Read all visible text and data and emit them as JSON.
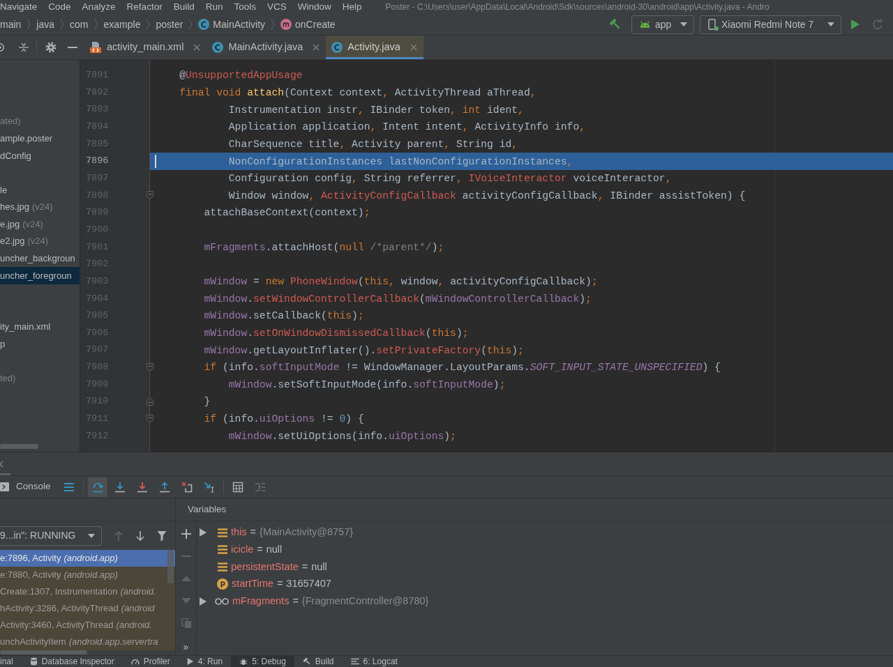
{
  "menu_bar": {
    "items": [
      "Navigate",
      "Code",
      "Analyze",
      "Refactor",
      "Build",
      "Run",
      "Tools",
      "VCS",
      "Window",
      "Help"
    ],
    "title": "Poster - C:\\Users\\user\\AppData\\Local\\Android\\Sdk\\sources\\android-30\\android\\app\\Activity.java - Andro"
  },
  "nav_bar": {
    "breadcrumbs": [
      {
        "text": "main",
        "kind": "folder"
      },
      {
        "text": "java",
        "kind": "folder"
      },
      {
        "text": "com",
        "kind": "folder"
      },
      {
        "text": "example",
        "kind": "folder"
      },
      {
        "text": "poster",
        "kind": "folder"
      },
      {
        "text": "MainActivity",
        "kind": "class"
      },
      {
        "text": "onCreate",
        "kind": "method"
      }
    ],
    "run_configuration": {
      "label": "app"
    },
    "device": {
      "label": "Xiaomi Redmi Note 7",
      "connected": true
    },
    "run_buttons": [
      {
        "kind": "run",
        "disabled": false
      },
      {
        "kind": "apply_changes",
        "disabled": true
      }
    ]
  },
  "editor_tabs": [
    {
      "label": "activity_main.xml",
      "kind": "xml",
      "selected": false
    },
    {
      "label": "MainActivity.java",
      "kind": "class",
      "selected": false
    },
    {
      "label": "Activity.java",
      "kind": "class",
      "selected": true
    }
  ],
  "project_tree": {
    "rows": [
      null,
      null,
      null,
      {
        "note": "ated)",
        "selected": false
      },
      {
        "text": "ample.poster",
        "selected": false
      },
      {
        "text": "dConfig",
        "selected": false
      },
      null,
      {
        "text": "le",
        "selected": false
      },
      {
        "text": "hes.jpg",
        "note": "(v24)",
        "selected": false
      },
      {
        "text": "e.jpg",
        "note": "(v24)",
        "selected": false
      },
      {
        "text": "e2.jpg",
        "note": "(v24)",
        "selected": false
      },
      {
        "text": "uncher_backgroun",
        "selected": false
      },
      {
        "text": "uncher_foregroun",
        "selected": true
      },
      null,
      null,
      {
        "text": "ity_main.xml",
        "selected": false
      },
      {
        "text": "p",
        "selected": false
      },
      null,
      {
        "note": "ted)",
        "selected": false
      }
    ]
  },
  "editor": {
    "lines": [
      {
        "number": "7891",
        "kind": "code",
        "current": false,
        "tokens": [
          {
            "kind": "plain",
            "text": "    @"
          },
          {
            "kind": "error",
            "text": "UnsupportedAppUsage"
          }
        ]
      },
      {
        "number": "7892",
        "kind": "code",
        "current": false,
        "tokens": [
          {
            "kind": "keyword",
            "text": "    final void "
          },
          {
            "kind": "declaration",
            "text": "attach"
          },
          {
            "kind": "plain",
            "text": "(Context context"
          },
          {
            "kind": "keyword",
            "text": ", "
          },
          {
            "kind": "plain",
            "text": "ActivityThread aThread"
          },
          {
            "kind": "keyword",
            "text": ","
          }
        ]
      },
      {
        "number": "7893",
        "kind": "code",
        "current": false,
        "tokens": [
          {
            "kind": "plain",
            "text": "            Instrumentation instr"
          },
          {
            "kind": "keyword",
            "text": ", "
          },
          {
            "kind": "plain",
            "text": "IBinder token"
          },
          {
            "kind": "keyword",
            "text": ", int "
          },
          {
            "kind": "plain",
            "text": "ident"
          },
          {
            "kind": "keyword",
            "text": ","
          }
        ]
      },
      {
        "number": "7894",
        "kind": "code",
        "current": false,
        "tokens": [
          {
            "kind": "plain",
            "text": "            Application application"
          },
          {
            "kind": "keyword",
            "text": ", "
          },
          {
            "kind": "plain",
            "text": "Intent intent"
          },
          {
            "kind": "keyword",
            "text": ", "
          },
          {
            "kind": "plain",
            "text": "ActivityInfo info"
          },
          {
            "kind": "keyword",
            "text": ","
          }
        ]
      },
      {
        "number": "7895",
        "kind": "code",
        "current": false,
        "tokens": [
          {
            "kind": "plain",
            "text": "            CharSequence title"
          },
          {
            "kind": "keyword",
            "text": ", "
          },
          {
            "kind": "plain",
            "text": "Activity parent"
          },
          {
            "kind": "keyword",
            "text": ", "
          },
          {
            "kind": "plain",
            "text": "String id"
          },
          {
            "kind": "keyword",
            "text": ","
          }
        ]
      },
      {
        "number": "7896",
        "kind": "code",
        "current": true,
        "tokens": [
          {
            "kind": "plain",
            "text": "            NonConfigurationInstances lastNonConfigurationInstances"
          },
          {
            "kind": "keyword",
            "text": ","
          }
        ]
      },
      {
        "number": "7897",
        "kind": "code",
        "current": false,
        "tokens": [
          {
            "kind": "plain",
            "text": "            Configuration config"
          },
          {
            "kind": "keyword",
            "text": ", "
          },
          {
            "kind": "plain",
            "text": "String referrer"
          },
          {
            "kind": "keyword",
            "text": ", "
          },
          {
            "kind": "error",
            "text": "IVoiceInteractor"
          },
          {
            "kind": "plain",
            "text": " voiceInteractor"
          },
          {
            "kind": "keyword",
            "text": ","
          }
        ]
      },
      {
        "number": "7898",
        "kind": "fold_start",
        "current": false,
        "tokens": [
          {
            "kind": "plain",
            "text": "            Window window"
          },
          {
            "kind": "keyword",
            "text": ", "
          },
          {
            "kind": "error",
            "text": "ActivityConfigCallback"
          },
          {
            "kind": "plain",
            "text": " activityConfigCallback"
          },
          {
            "kind": "keyword",
            "text": ", "
          },
          {
            "kind": "plain",
            "text": "IBinder assistToken) {"
          }
        ]
      },
      {
        "number": "7899",
        "kind": "code",
        "current": false,
        "tokens": [
          {
            "kind": "plain",
            "text": "        attachBaseContext(context)"
          },
          {
            "kind": "keyword",
            "text": ";"
          }
        ]
      },
      {
        "number": "7900",
        "kind": "code",
        "current": false
      },
      {
        "number": "7901",
        "kind": "code",
        "current": false,
        "tokens": [
          {
            "kind": "field",
            "text": "        mFragments"
          },
          {
            "kind": "plain",
            "text": ".attachHost("
          },
          {
            "kind": "keyword",
            "text": "null "
          },
          {
            "kind": "comment",
            "text": "/*parent*/"
          },
          {
            "kind": "plain",
            "text": ")"
          },
          {
            "kind": "keyword",
            "text": ";"
          }
        ]
      },
      {
        "number": "7902",
        "kind": "code",
        "current": false
      },
      {
        "number": "7903",
        "kind": "code",
        "current": false,
        "tokens": [
          {
            "kind": "field",
            "text": "        mWindow"
          },
          {
            "kind": "plain",
            "text": " = "
          },
          {
            "kind": "keyword",
            "text": "new "
          },
          {
            "kind": "error",
            "text": "PhoneWindow"
          },
          {
            "kind": "plain",
            "text": "("
          },
          {
            "kind": "keyword",
            "text": "this, "
          },
          {
            "kind": "plain",
            "text": "window"
          },
          {
            "kind": "keyword",
            "text": ", "
          },
          {
            "kind": "plain",
            "text": "activityConfigCallback)"
          },
          {
            "kind": "keyword",
            "text": ";"
          }
        ]
      },
      {
        "number": "7904",
        "kind": "code",
        "current": false,
        "tokens": [
          {
            "kind": "field",
            "text": "        mWindow"
          },
          {
            "kind": "plain",
            "text": "."
          },
          {
            "kind": "error",
            "text": "setWindowControllerCallback"
          },
          {
            "kind": "plain",
            "text": "("
          },
          {
            "kind": "field",
            "text": "mWindowControllerCallback"
          },
          {
            "kind": "plain",
            "text": ")"
          },
          {
            "kind": "keyword",
            "text": ";"
          }
        ]
      },
      {
        "number": "7905",
        "kind": "code",
        "current": false,
        "tokens": [
          {
            "kind": "field",
            "text": "        mWindow"
          },
          {
            "kind": "plain",
            "text": ".setCallback("
          },
          {
            "kind": "keyword",
            "text": "this"
          },
          {
            "kind": "plain",
            "text": ")"
          },
          {
            "kind": "keyword",
            "text": ";"
          }
        ]
      },
      {
        "number": "7906",
        "kind": "code",
        "current": false,
        "tokens": [
          {
            "kind": "field",
            "text": "        mWindow"
          },
          {
            "kind": "plain",
            "text": "."
          },
          {
            "kind": "error",
            "text": "setOnWindowDismissedCallback"
          },
          {
            "kind": "plain",
            "text": "("
          },
          {
            "kind": "keyword",
            "text": "this"
          },
          {
            "kind": "plain",
            "text": ")"
          },
          {
            "kind": "keyword",
            "text": ";"
          }
        ]
      },
      {
        "number": "7907",
        "kind": "code",
        "current": false,
        "tokens": [
          {
            "kind": "field",
            "text": "        mWindow"
          },
          {
            "kind": "plain",
            "text": ".getLayoutInflater()."
          },
          {
            "kind": "error",
            "text": "setPrivateFactory"
          },
          {
            "kind": "plain",
            "text": "("
          },
          {
            "kind": "keyword",
            "text": "this"
          },
          {
            "kind": "plain",
            "text": ")"
          },
          {
            "kind": "keyword",
            "text": ";"
          }
        ]
      },
      {
        "number": "7908",
        "kind": "fold_start",
        "current": false,
        "tokens": [
          {
            "kind": "keyword",
            "text": "        if "
          },
          {
            "kind": "plain",
            "text": "(info."
          },
          {
            "kind": "field",
            "text": "softInputMode"
          },
          {
            "kind": "plain",
            "text": " != WindowManager.LayoutParams."
          },
          {
            "kind": "constant",
            "text": "SOFT_INPUT_STATE_UNSPECIFIED"
          },
          {
            "kind": "plain",
            "text": ") {"
          }
        ]
      },
      {
        "number": "7909",
        "kind": "code",
        "current": false,
        "tokens": [
          {
            "kind": "field",
            "text": "            mWindow"
          },
          {
            "kind": "plain",
            "text": ".setSoftInputMode(info."
          },
          {
            "kind": "field",
            "text": "softInputMode"
          },
          {
            "kind": "plain",
            "text": ")"
          },
          {
            "kind": "keyword",
            "text": ";"
          }
        ]
      },
      {
        "number": "7910",
        "kind": "fold_end",
        "current": false,
        "tokens": [
          {
            "kind": "plain",
            "text": "        }"
          }
        ]
      },
      {
        "number": "7911",
        "kind": "fold_start",
        "current": false,
        "tokens": [
          {
            "kind": "keyword",
            "text": "        if "
          },
          {
            "kind": "plain",
            "text": "(info."
          },
          {
            "kind": "field",
            "text": "uiOptions"
          },
          {
            "kind": "plain",
            "text": " != "
          },
          {
            "kind": "number",
            "text": "0"
          },
          {
            "kind": "plain",
            "text": ") {"
          }
        ]
      },
      {
        "number": "7912",
        "kind": "code",
        "current": false,
        "tokens": [
          {
            "kind": "field",
            "text": "            mWindow"
          },
          {
            "kind": "plain",
            "text": ".setUiOptions(info."
          },
          {
            "kind": "field",
            "text": "uiOptions"
          },
          {
            "kind": "plain",
            "text": ")"
          },
          {
            "kind": "keyword",
            "text": ";"
          }
        ]
      }
    ]
  },
  "debugger": {
    "toolbar": {
      "console_label": "Console",
      "buttons": [
        {
          "kind": "execution_point",
          "pressed": false,
          "disabled": false
        },
        {
          "kind": "step_over",
          "pressed": true,
          "disabled": false
        },
        {
          "kind": "step_into",
          "pressed": false,
          "disabled": false
        },
        {
          "kind": "force_step_into",
          "pressed": false,
          "disabled": false
        },
        {
          "kind": "step_out",
          "pressed": false,
          "disabled": false
        },
        {
          "kind": "drop_frame",
          "pressed": false,
          "disabled": false
        },
        {
          "kind": "run_to_cursor",
          "pressed": false,
          "disabled": false
        },
        {
          "kind": "evaluate",
          "pressed": false,
          "disabled": false
        },
        {
          "kind": "trace",
          "pressed": false,
          "disabled": true
        }
      ]
    },
    "thread": "9...in\": RUNNING",
    "frame_nav": [
      {
        "kind": "up",
        "disabled": true
      },
      {
        "kind": "down",
        "disabled": false
      },
      {
        "kind": "filter",
        "disabled": false
      }
    ],
    "frames": [
      {
        "location": "e:7896, Activity",
        "package": "(android.app)",
        "selected": true
      },
      {
        "location": "e:7880, Activity",
        "package": "(android.app)",
        "selected": false
      },
      {
        "location": "Create:1307, Instrumentation",
        "package": "(android.",
        "selected": false
      },
      {
        "location": "hActivity:3286, ActivityThread",
        "package": "(android",
        "selected": false
      },
      {
        "location": "Activity:3460, ActivityThread",
        "package": "(android.",
        "selected": false
      },
      {
        "location": "unchActivityItem",
        "package": "(android.app.servertra",
        "selected": false
      }
    ],
    "variables_title": "Variables",
    "watch_buttons": [
      {
        "kind": "add",
        "disabled": false
      },
      {
        "kind": "remove",
        "disabled": true
      },
      {
        "kind": "up",
        "disabled": true
      },
      {
        "kind": "down",
        "disabled": true
      },
      {
        "kind": "copy",
        "disabled": true
      }
    ],
    "more": "»",
    "variables": [
      {
        "name": "this",
        "separator": "=",
        "value": "{MainActivity@8757}",
        "kind": "field",
        "expandable": true,
        "reference": true
      },
      {
        "name": "icicle",
        "separator": "=",
        "value": "null",
        "kind": "field",
        "expandable": false,
        "reference": false
      },
      {
        "name": "persistentState",
        "separator": "=",
        "value": "null",
        "kind": "field",
        "expandable": false,
        "reference": false
      },
      {
        "name": "startTime",
        "separator": "=",
        "value": "31657407",
        "kind": "parameter",
        "expandable": false,
        "reference": false
      },
      {
        "name": "mFragments",
        "separator": "=",
        "value": "{FragmentController@8780}",
        "kind": "watch",
        "expandable": true,
        "reference": true
      }
    ]
  },
  "tool_windows": [
    {
      "label": "inal",
      "kind": "terminal",
      "selected": false
    },
    {
      "label": "Database Inspector",
      "kind": "database",
      "selected": false
    },
    {
      "label": "Profiler",
      "kind": "profiler",
      "selected": false
    },
    {
      "label": "4: Run",
      "kind": "run",
      "selected": false
    },
    {
      "label": "5: Debug",
      "kind": "debug",
      "selected": true
    },
    {
      "label": "Build",
      "kind": "build",
      "selected": false
    },
    {
      "label": "6: Logcat",
      "kind": "logcat",
      "selected": false
    }
  ]
}
